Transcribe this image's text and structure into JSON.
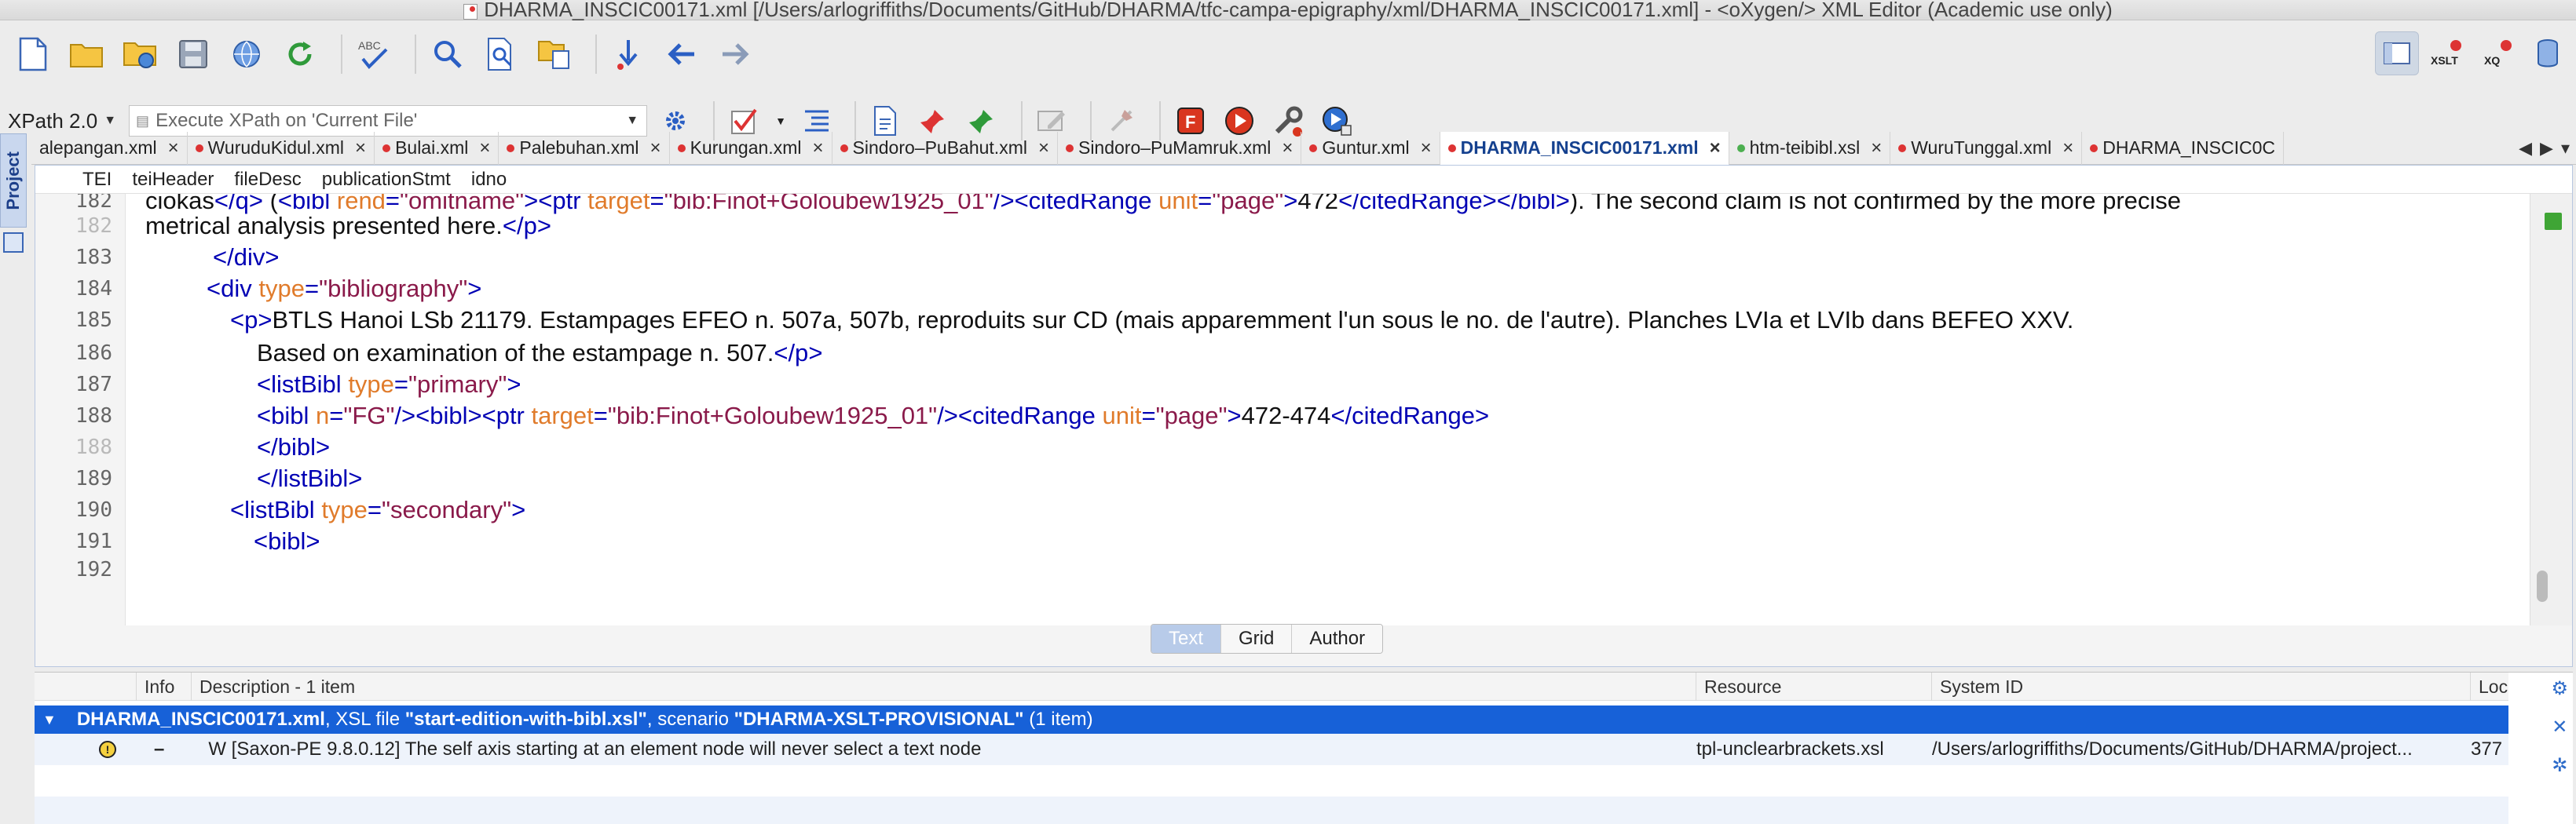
{
  "window": {
    "title": "DHARMA_INSCIC00171.xml [/Users/arlogriffiths/Documents/GitHub/DHARMA/tfc-campa-epigraphy/xml/DHARMA_INSCIC00171.xml] - <oXygen/> XML Editor (Academic use only)"
  },
  "toolbar": {
    "buttons": [
      "new-file-icon",
      "open-folder-icon",
      "open-url-icon",
      "save-icon",
      "save-all-icon",
      "reload-icon",
      "spellcheck-icon",
      "find-icon",
      "find-in-files-icon",
      "copy-icon",
      "back-icon",
      "forward-icon"
    ],
    "right_labels": {
      "xslt": "XSLT",
      "xq": "XQ"
    }
  },
  "xpath": {
    "version": "XPath 2.0",
    "placeholder": "Execute XPath on  'Current File'"
  },
  "sidebar": {
    "project_tab": "Project"
  },
  "tabs": [
    {
      "label": "alepangan.xml",
      "dot": "#d33",
      "active": false
    },
    {
      "label": "WuruduKidul.xml",
      "dot": "#d33",
      "active": false
    },
    {
      "label": "Bulai.xml",
      "dot": "#d33",
      "active": false
    },
    {
      "label": "Palebuhan.xml",
      "dot": "#d33",
      "active": false
    },
    {
      "label": "Kurungan.xml",
      "dot": "#d33",
      "active": false
    },
    {
      "label": "Sindoro–PuBahut.xml",
      "dot": "#d33",
      "active": false
    },
    {
      "label": "Sindoro–PuMamruk.xml",
      "dot": "#d33",
      "active": false
    },
    {
      "label": "Guntur.xml",
      "dot": "#d33",
      "active": false
    },
    {
      "label": "DHARMA_INSCIC00171.xml",
      "dot": "#d33",
      "active": true
    },
    {
      "label": "htm-teibibl.xsl",
      "dot": "#4caf50",
      "active": false
    },
    {
      "label": "WuruTunggal.xml",
      "dot": "#d33",
      "active": false
    },
    {
      "label": "DHARMA_INSCIC0C",
      "dot": "#d33",
      "active": false
    }
  ],
  "breadcrumb": [
    "TEI",
    "teiHeader",
    "fileDesc",
    "publicationStmt",
    "idno"
  ],
  "editor": {
    "lines": [
      {
        "num": "182",
        "text": "ciokas</q> (<bibl rend=\"omitname\"><ptr target=\"bib:Finot+Goloubew1925_01\"/><citedRange unit=\"page\">472</citedRange></bibl>). The second claim is not confirmed by the more precise"
      },
      {
        "num": "182",
        "text": "metrical analysis presented here.</p>"
      },
      {
        "num": "183",
        "text": "</div>"
      },
      {
        "num": "184",
        "text": "<div type=\"bibliography\">"
      },
      {
        "num": "185",
        "text": "<p>BTLS Hanoi LSb 21179. Estampages EFEO n. 507a, 507b, reproduits sur CD (mais apparemment l'un sous le no. de l'autre). Planches LVIa et LVIb dans BEFEO XXV."
      },
      {
        "num": "186",
        "text": "Based on examination of the estampage n. 507.</p>"
      },
      {
        "num": "187",
        "text": "<listBibl type=\"primary\">"
      },
      {
        "num": "188",
        "text": "<bibl n=\"FG\"/><bibl><ptr target=\"bib:Finot+Goloubew1925_01\"/><citedRange unit=\"page\">472-474</citedRange>"
      },
      {
        "num": "188",
        "text": "</bibl>"
      },
      {
        "num": "189",
        "text": "</listBibl>"
      },
      {
        "num": "190",
        "text": "<listBibl type=\"secondary\">"
      },
      {
        "num": "191",
        "text": "<bibl>"
      },
      {
        "num": "192",
        "text": ""
      }
    ]
  },
  "modes": [
    "Text",
    "Grid",
    "Author"
  ],
  "results": {
    "columns": {
      "info": "Info",
      "description": "Description - 1 item",
      "resource": "Resource",
      "system_id": "System ID",
      "location": "Loc"
    },
    "group": {
      "file": "DHARMA_INSCIC00171.xml",
      "text1": ", XSL file ",
      "xsl": "\"start-edition-with-bibl.xsl\"",
      "text2": ", scenario ",
      "scenario": "\"DHARMA-XSLT-PROVISIONAL\"",
      "count": " (1 item)"
    },
    "row": {
      "dash": "–",
      "description": "W [Saxon-PE 9.8.0.12] The self axis starting at an element node will never select a text node",
      "resource": "tpl-unclearbrackets.xsl",
      "system_id": "/Users/arlogriffiths/Documents/GitHub/DHARMA/project...",
      "location": "377"
    }
  }
}
